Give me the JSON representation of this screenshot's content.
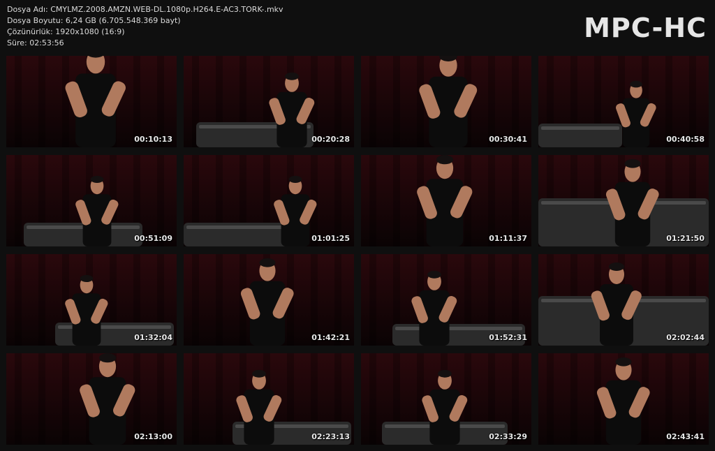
{
  "info": {
    "filename": "Dosya Adı: CMYLMZ.2008.AMZN.WEB-DL.1080p.H264.E-AC3.TORK-.mkv",
    "filesize": "Dosya Boyutu: 6,24 GB (6.705.548.369 bayt)",
    "resolution": "Çözünürlük: 1920x1080 (16:9)",
    "duration": "Süre: 02:53:56"
  },
  "logo": "MPC-HC",
  "thumbnails": [
    {
      "timestamp": "00:10:13"
    },
    {
      "timestamp": "00:20:28"
    },
    {
      "timestamp": "00:30:41"
    },
    {
      "timestamp": "00:40:58"
    },
    {
      "timestamp": "00:51:09"
    },
    {
      "timestamp": "01:01:25"
    },
    {
      "timestamp": "01:11:37"
    },
    {
      "timestamp": "01:21:50"
    },
    {
      "timestamp": "01:32:04"
    },
    {
      "timestamp": "01:42:21"
    },
    {
      "timestamp": "01:52:31"
    },
    {
      "timestamp": "02:02:44"
    },
    {
      "timestamp": "02:13:00"
    },
    {
      "timestamp": "02:23:13"
    },
    {
      "timestamp": "02:33:29"
    },
    {
      "timestamp": "02:43:41"
    }
  ],
  "colors": {
    "background": "#0f0f0f",
    "curtain": "#2a080c",
    "sofa": "#2b2b2b",
    "shirt": "#0c0c0c",
    "skin": "#b07a5e"
  }
}
